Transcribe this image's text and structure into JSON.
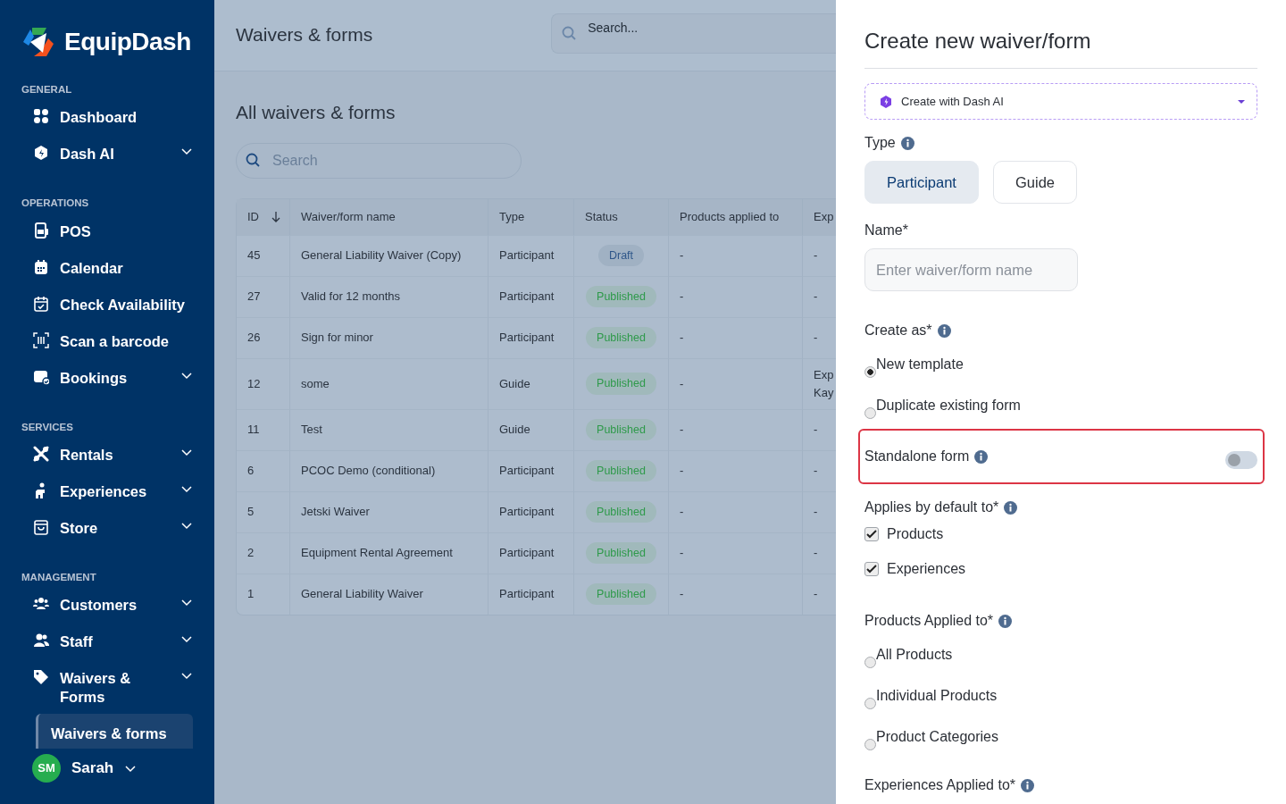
{
  "brand": {
    "name": "EquipDash"
  },
  "sidebar": {
    "sections": [
      {
        "heading": "GENERAL",
        "items": [
          {
            "label": "Dashboard",
            "has_submenu": false,
            "selected": false
          },
          {
            "label": "Dash AI",
            "has_submenu": true,
            "selected": false
          }
        ]
      },
      {
        "heading": "OPERATIONS",
        "items": [
          {
            "label": "POS",
            "has_submenu": false,
            "selected": false
          },
          {
            "label": "Calendar",
            "has_submenu": false,
            "selected": false
          },
          {
            "label": "Check Availability",
            "has_submenu": false,
            "selected": false
          },
          {
            "label": "Scan a barcode",
            "has_submenu": false,
            "selected": false
          },
          {
            "label": "Bookings",
            "has_submenu": true,
            "selected": false
          }
        ]
      },
      {
        "heading": "SERVICES",
        "items": [
          {
            "label": "Rentals",
            "has_submenu": true,
            "selected": false
          },
          {
            "label": "Experiences",
            "has_submenu": true,
            "selected": false
          },
          {
            "label": "Store",
            "has_submenu": true,
            "selected": false
          }
        ]
      },
      {
        "heading": "MANAGEMENT",
        "items": [
          {
            "label": "Customers",
            "has_submenu": true,
            "selected": false
          },
          {
            "label": "Staff",
            "has_submenu": true,
            "selected": false
          },
          {
            "label": "Waivers & Forms",
            "has_submenu": true,
            "selected": false,
            "children": [
              {
                "label": "Waivers & forms",
                "selected": true
              }
            ]
          }
        ]
      }
    ],
    "user": {
      "initials": "SM",
      "name": "Sarah"
    }
  },
  "header": {
    "title": "Waivers & forms",
    "search": {
      "placeholder": "Search..."
    }
  },
  "content": {
    "title": "All waivers & forms",
    "search": {
      "placeholder": "Search"
    },
    "table": {
      "columns": [
        "ID",
        "Waiver/form name",
        "Type",
        "Status",
        "Products applied to",
        "Exp"
      ],
      "rows": [
        {
          "id": "45",
          "name": "General Liability Waiver (Copy)",
          "type": "Participant",
          "status": {
            "label": "Draft",
            "kind": "draft"
          },
          "products": "-",
          "column_6": "-"
        },
        {
          "id": "27",
          "name": "Valid for 12 months",
          "type": "Participant",
          "status": {
            "label": "Published",
            "kind": "published"
          },
          "products": "-",
          "column_6": "-"
        },
        {
          "id": "26",
          "name": "Sign for minor",
          "type": "Participant",
          "status": {
            "label": "Published",
            "kind": "published"
          },
          "products": "-",
          "column_6": "-"
        },
        {
          "id": "12",
          "name": "some",
          "type": "Guide",
          "status": {
            "label": "Published",
            "kind": "published"
          },
          "products": "-",
          "column_6": "Exp Kay"
        },
        {
          "id": "11",
          "name": "Test",
          "type": "Guide",
          "status": {
            "label": "Published",
            "kind": "published"
          },
          "products": "-",
          "column_6": "-"
        },
        {
          "id": "6",
          "name": "PCOC Demo (conditional)",
          "type": "Participant",
          "status": {
            "label": "Published",
            "kind": "published"
          },
          "products": "-",
          "column_6": "-"
        },
        {
          "id": "5",
          "name": "Jetski Waiver",
          "type": "Participant",
          "status": {
            "label": "Published",
            "kind": "published"
          },
          "products": "-",
          "column_6": "-"
        },
        {
          "id": "2",
          "name": "Equipment Rental Agreement",
          "type": "Participant",
          "status": {
            "label": "Published",
            "kind": "published"
          },
          "products": "-",
          "column_6": "-"
        },
        {
          "id": "1",
          "name": "General Liability Waiver",
          "type": "Participant",
          "status": {
            "label": "Published",
            "kind": "published"
          },
          "products": "-",
          "column_6": "-"
        }
      ]
    }
  },
  "panel": {
    "title": "Create new waiver/form",
    "ai_dropdown": "Create with Dash AI",
    "type": {
      "label": "Type",
      "options": [
        {
          "label": "Participant",
          "selected": true
        },
        {
          "label": "Guide",
          "selected": false
        }
      ]
    },
    "name": {
      "label": "Name*",
      "placeholder": "Enter waiver/form name"
    },
    "create_as": {
      "label": "Create as*",
      "options": [
        {
          "label": "New template",
          "selected": true
        },
        {
          "label": "Duplicate existing form",
          "selected": false
        }
      ]
    },
    "standalone": {
      "label": "Standalone form",
      "on": false
    },
    "applies_by_default": {
      "label": "Applies by default to*",
      "options": [
        {
          "label": "Products",
          "checked": true
        },
        {
          "label": "Experiences",
          "checked": true
        }
      ]
    },
    "products_applied": {
      "label": "Products Applied to*",
      "options": [
        {
          "label": "All Products",
          "selected": false
        },
        {
          "label": "Individual Products",
          "selected": false
        },
        {
          "label": "Product Categories",
          "selected": false
        }
      ]
    },
    "experiences_applied": {
      "label": "Experiences Applied to*"
    }
  }
}
